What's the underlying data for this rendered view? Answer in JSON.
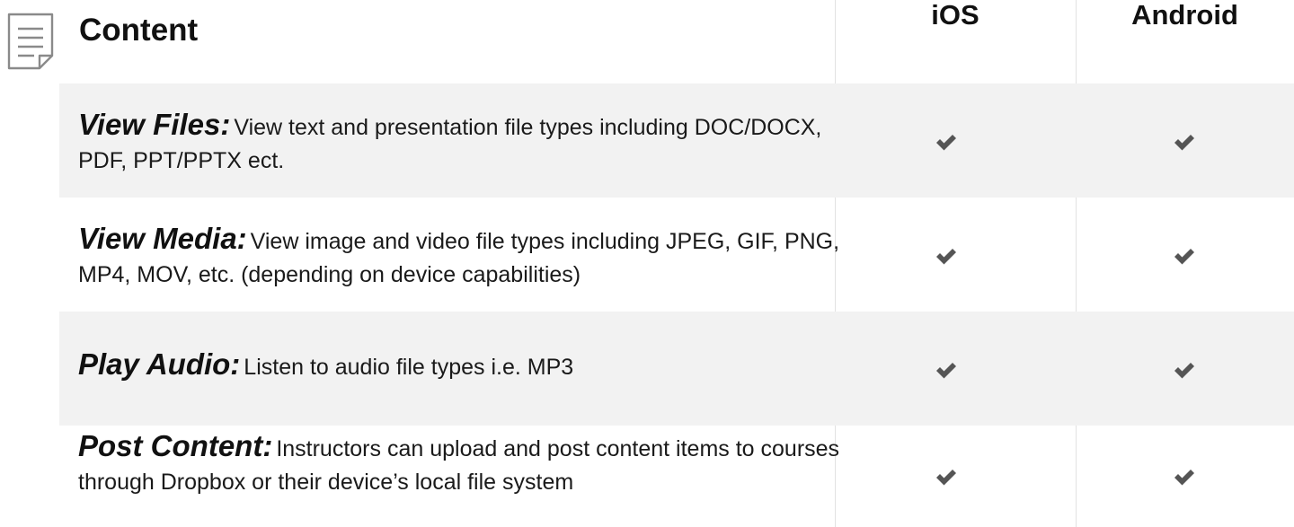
{
  "header": {
    "title": "Content",
    "icon": "document-icon",
    "columns": [
      "iOS",
      "Android"
    ]
  },
  "rows": [
    {
      "feature": "View Files:",
      "description": "View text and presentation file types including DOC/DOCX, PDF, PPT/PPTX ect.",
      "ios": true,
      "android": true
    },
    {
      "feature": "View Media:",
      "description": "View image and video file types including JPEG, GIF, PNG, MP4, MOV, etc. (depending on device capabilities)",
      "ios": true,
      "android": true
    },
    {
      "feature": "Play Audio:",
      "description": "Listen to audio file types i.e. MP3",
      "ios": true,
      "android": true
    },
    {
      "feature": "Post Content:",
      "description": "Instructors can upload and post content items to courses through Dropbox or their device’s local file system",
      "ios": true,
      "android": true
    }
  ],
  "colors": {
    "row_shade": "#f2f2f2",
    "check": "#555555",
    "icon": "#8a8a8a"
  }
}
